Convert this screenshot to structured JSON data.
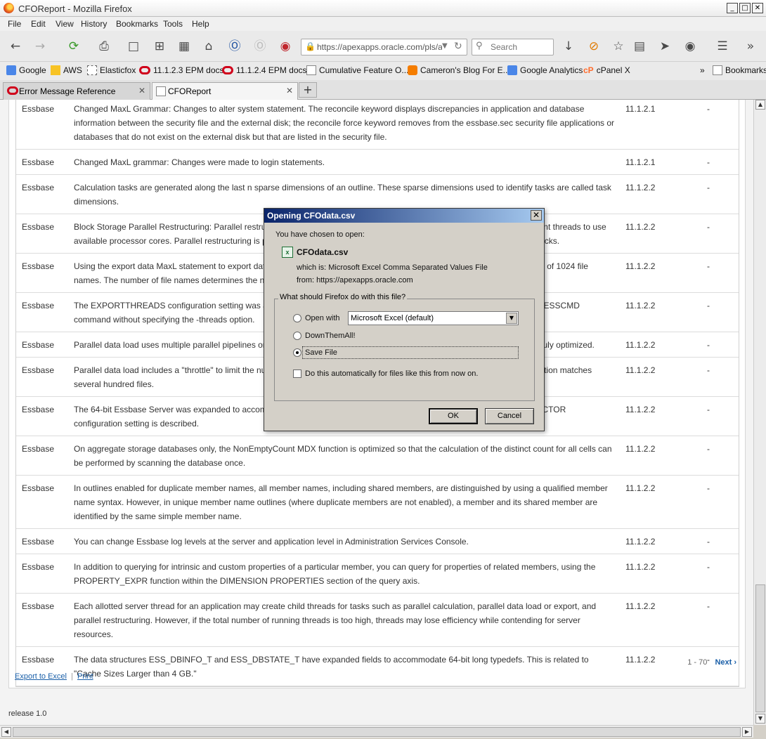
{
  "window": {
    "title": "CFOReport - Mozilla Firefox",
    "controls": [
      "_",
      "□",
      "✕"
    ]
  },
  "menu": [
    "File",
    "Edit",
    "View",
    "History",
    "Bookmarks",
    "Tools",
    "Help"
  ],
  "toolbar": {
    "url": "https://apexapps.oracle.com/pls/apex/f?p=",
    "search_placeholder": "Search"
  },
  "bookmarks": [
    "Google",
    "AWS",
    "Elasticfox",
    "11.1.2.3 EPM docs",
    "11.1.2.4 EPM docs",
    "Cumulative Feature O...",
    "Cameron's Blog For E...",
    "Google Analytics",
    "cPanel X"
  ],
  "bookmarks_overflow": "»",
  "bookmarks_menu": "Bookmarks",
  "tabs": [
    {
      "label": "Error Message Reference",
      "close": "✕"
    },
    {
      "label": "CFOReport",
      "close": "✕"
    }
  ],
  "new_tab": "+",
  "rows": [
    {
      "product": "Essbase",
      "desc": "Changed MaxL Grammar: Changes to alter system statement. The reconcile keyword displays discrepancies in application and database information between the security file and the external disk; the reconcile force keyword removes from the essbase.sec security file applications or databases that do not exist on the external disk but that are listed in the security file.",
      "version": "11.1.2.1",
      "extra": "-"
    },
    {
      "product": "Essbase",
      "desc": "Changed MaxL grammar: Changes were made to login statements.",
      "version": "11.1.2.1",
      "extra": "-"
    },
    {
      "product": "Essbase",
      "desc": "Calculation tasks are generated along the last n sparse dimensions of an outline. These sparse dimensions used to identify tasks are called task dimensions.",
      "version": "11.1.2.2",
      "extra": "-"
    },
    {
      "product": "Essbase",
      "desc": "Block Storage Parallel Restructuring: Parallel restructuring distributes the restructuring of data blocks across multiple concurrent threads to use available processor cores. Parallel restructuring is possible because each block can be restructured independently of other blocks.",
      "version": "11.1.2.2",
      "extra": "-"
    },
    {
      "product": "Essbase",
      "desc": "Using the export data MaxL statement to export data, you can specify a comma-separated list of export files, up to a maximum of 1024 file names. The number of file names determines the number of export threads.",
      "version": "11.1.2.2",
      "extra": "-"
    },
    {
      "product": "Essbase",
      "desc": "The EXPORTTHREADS configuration setting was added. EXPORTTHREADS is used only when executing the PAREXPORT ESSCMD command without specifying the -threads option.",
      "version": "11.1.2.2",
      "extra": "-"
    },
    {
      "product": "Essbase",
      "desc": "Parallel data load uses multiple parallel pipelines on the server side to load data files concurrently, enabling data loads to be truly optimized.",
      "version": "11.1.2.2",
      "extra": "-"
    },
    {
      "product": "Essbase",
      "desc": "Parallel data load includes a \"throttle\" to limit the number of files loaded concurrently. This is important: if the data-file specification matches several hundred files.",
      "version": "11.1.2.2",
      "extra": "-"
    },
    {
      "product": "Essbase",
      "desc": "The 64-bit Essbase Server was expanded to accommodate the MEMSCALINGFACTOR scaling factor. The MEMSCALINGFACTOR configuration setting is described.",
      "version": "11.1.2.2",
      "extra": "-"
    },
    {
      "product": "Essbase",
      "desc": "On aggregate storage databases only, the NonEmptyCount MDX function is optimized so that the calculation of the distinct count for all cells can be performed by scanning the database once.",
      "version": "11.1.2.2",
      "extra": "-"
    },
    {
      "product": "Essbase",
      "desc": "In outlines enabled for duplicate member names, all member names, including shared members, are distinguished by using a qualified member name syntax. However, in unique member name outlines (where duplicate members are not enabled), a member and its shared member are identified by the same simple member name.",
      "version": "11.1.2.2",
      "extra": "-"
    },
    {
      "product": "Essbase",
      "desc": "You can change Essbase log levels at the server and application level in Administration Services Console.",
      "version": "11.1.2.2",
      "extra": "-"
    },
    {
      "product": "Essbase",
      "desc": "In addition to querying for intrinsic and custom properties of a particular member, you can query for properties of related members, using the PROPERTY_EXPR function within the DIMENSION PROPERTIES section of the query axis.",
      "version": "11.1.2.2",
      "extra": "-"
    },
    {
      "product": "Essbase",
      "desc": "Each allotted server thread for an application may create child threads for tasks such as parallel calculation, parallel data load or export, and parallel restructuring. However, if the total number of running threads is too high, threads may lose efficiency while contending for server resources.",
      "version": "11.1.2.2",
      "extra": "-"
    },
    {
      "product": "Essbase",
      "desc": "The data structures ESS_DBINFO_T and ESS_DBSTATE_T have expanded fields to accommodate 64-bit long typedefs. This is related to \"Cache Sizes Larger than 4 GB.\"",
      "version": "11.1.2.2",
      "extra": "-"
    }
  ],
  "pager": {
    "range": "1 - 70",
    "next": "Next ›"
  },
  "footer_links": {
    "export": "Export to Excel",
    "separator": "|",
    "print": "Print"
  },
  "release": "release 1.0",
  "dialog": {
    "title": "Opening CFOdata.csv",
    "close": "✕",
    "intro": "You have chosen to open:",
    "filename": "CFOdata.csv",
    "which_is": "which is:  Microsoft Excel Comma Separated Values File",
    "from": "from:  https://apexapps.oracle.com",
    "question": "What should Firefox do with this file?",
    "open_with_label": "Open with",
    "open_with_value": "Microsoft Excel (default)",
    "downthemall": "DownThemAll!",
    "save_file": "Save File",
    "auto_label": "Do this automatically for files like this from now on.",
    "ok": "OK",
    "cancel": "Cancel",
    "selected_option": "save_file"
  }
}
